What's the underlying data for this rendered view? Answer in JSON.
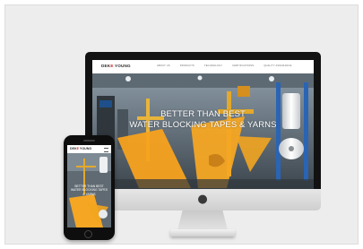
{
  "site": {
    "logo_prefix": "DEK",
    "logo_accent": "E",
    "logo_suffix": " YOUNG",
    "menu": [
      "ABOUT US",
      "PRODUCTS",
      "TECHNOLOGY",
      "CERTIFICATIONS",
      "QUALITY ASSURANCE"
    ],
    "headline_line1": "BETTER THAN BEST",
    "headline_line2": "WATER BLOCKING TAPES & YARNS"
  },
  "mobile": {
    "headline_line1": "BETTER THAN BEST",
    "headline_line2": "WATER BLOCKING TAPES",
    "headline_line3": "& YARNS"
  },
  "device": {
    "apple_logo": "apple-logo-icon"
  },
  "colors": {
    "brand_red": "#d81e22",
    "accent_orange": "#f5a623",
    "page_bg": "#ededed"
  }
}
